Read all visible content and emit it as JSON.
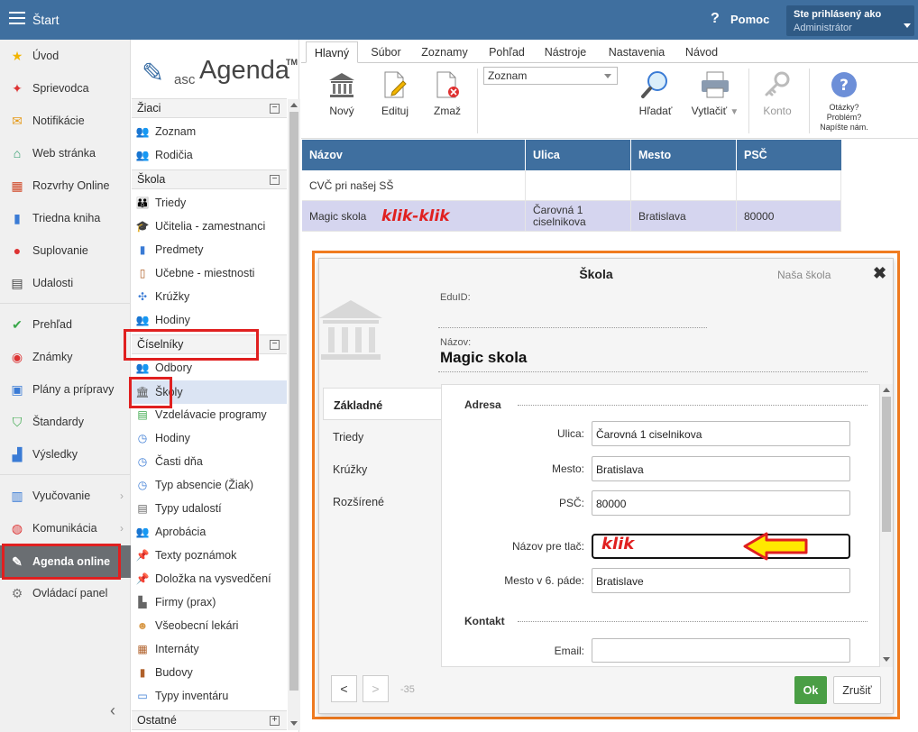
{
  "topbar": {
    "title": "Štart",
    "help": "Pomoc",
    "user_line1": "Ste prihlásený ako",
    "user_line2": "Administrátor"
  },
  "leftnav": [
    {
      "label": "Úvod",
      "icon": "star-icon"
    },
    {
      "label": "Sprievodca",
      "icon": "magic-wand-icon"
    },
    {
      "label": "Notifikácie",
      "icon": "envelope-icon"
    },
    {
      "label": "Web stránka",
      "icon": "home-icon"
    },
    {
      "label": "Rozvrhy Online",
      "icon": "calendar-grid-icon"
    },
    {
      "label": "Triedna kniha",
      "icon": "book-icon"
    },
    {
      "label": "Suplovanie",
      "icon": "person-icon"
    },
    {
      "label": "Udalosti",
      "icon": "calendar-icon"
    },
    {
      "label": "Prehľad",
      "icon": "check-circle-icon"
    },
    {
      "label": "Známky",
      "icon": "grade-icon"
    },
    {
      "label": "Plány a prípravy",
      "icon": "briefcase-icon"
    },
    {
      "label": "Štandardy",
      "icon": "shield-check-icon"
    },
    {
      "label": "Výsledky",
      "icon": "bar-chart-icon"
    },
    {
      "label": "Vyučovanie",
      "icon": "open-book-icon"
    },
    {
      "label": "Komunikácia",
      "icon": "chat-icon"
    },
    {
      "label": "Agenda online",
      "icon": "pen-icon"
    },
    {
      "label": "Ovládací panel",
      "icon": "gear-icon"
    }
  ],
  "logo": {
    "asc": "asc",
    "agenda": "Agenda",
    "tm": "TM"
  },
  "mid": {
    "sec_ziaci": "Žiaci",
    "ziaci_items": [
      "Zoznam",
      "Rodičia"
    ],
    "sec_skola": "Škola",
    "skola_items": [
      "Triedy",
      "Učitelia - zamestnanci",
      "Predmety",
      "Učebne - miestnosti",
      "Krúžky",
      "Hodiny"
    ],
    "sec_ciselniky": "Číselníky",
    "ciselniky_items": [
      "Odbory",
      "Školy",
      "Vzdelávacie programy",
      "Hodiny",
      "Časti dňa",
      "Typ absencie (Žiak)",
      "Typy udalostí",
      "Aprobácia",
      "Texty poznámok",
      "Doložka na vysvedčení",
      "Firmy (prax)",
      "Všeobecní lekári",
      "Internáty",
      "Budovy",
      "Typy inventáru"
    ],
    "sec_ostatne": "Ostatné"
  },
  "menutabs": [
    "Hlavný",
    "Súbor",
    "Zoznamy",
    "Pohľad",
    "Nástroje",
    "Nastavenia",
    "Návod"
  ],
  "ribbon": {
    "novy": "Nový",
    "edituj": "Edituj",
    "zmaz": "Zmaž",
    "zoznam": "Zoznam",
    "hladat": "Hľadať",
    "vytlacit": "Vytlačiť",
    "konto": "Konto",
    "help1": "Otázky?",
    "help2": "Problém?",
    "help3": "Napíšte nám."
  },
  "grid": {
    "headers": [
      "Názov",
      "Ulica",
      "Mesto",
      "PSČ"
    ],
    "rows": [
      {
        "nazov": "CVČ pri našej SŠ",
        "ulica": "",
        "mesto": "",
        "psc": ""
      },
      {
        "nazov": "Magic skola",
        "ulica": "Čarovná 1 ciselnikova",
        "mesto": "Bratislava",
        "psc": "80000"
      }
    ],
    "annotation": "klik-klik"
  },
  "dialog": {
    "title": "Škola",
    "subtitle": "Naša škola",
    "eduid_label": "EduID:",
    "nazov_label": "Názov:",
    "nazov": "Magic skola",
    "tabs": [
      "Základné",
      "Triedy",
      "Krúžky",
      "Rozšírené"
    ],
    "group_adresa": "Adresa",
    "group_kontakt": "Kontakt",
    "ulica_label": "Ulica:",
    "ulica": "Čarovná 1 ciselnikova",
    "mesto_label": "Mesto:",
    "mesto": "Bratislava",
    "psc_label": "PSČ:",
    "psc": "80000",
    "print_label": "Názov pre tlač:",
    "print_annotation": "klik",
    "mesto6_label": "Mesto v 6. páde:",
    "mesto6": "Bratislave",
    "email_label": "Email:",
    "page_num": "-35",
    "prev": "<",
    "next": ">",
    "ok": "Ok",
    "cancel": "Zrušiť"
  }
}
